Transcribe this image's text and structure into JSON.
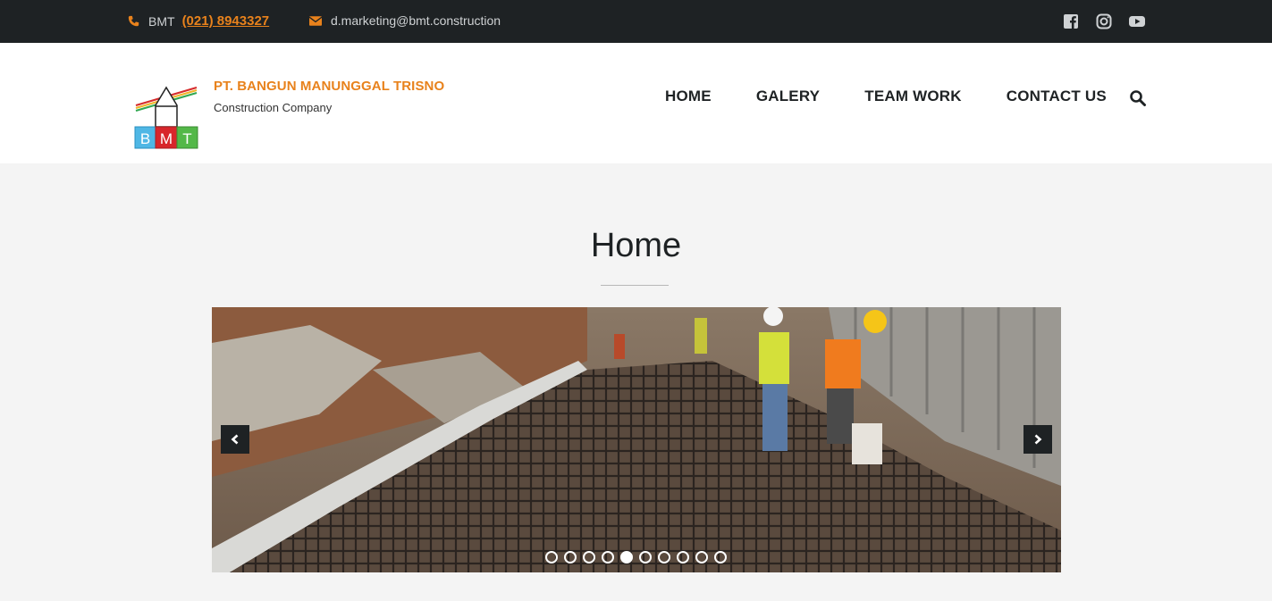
{
  "topbar": {
    "phone_brand": "BMT",
    "phone_number": "(021) 8943327",
    "email": "d.marketing@bmt.construction",
    "social": [
      "facebook-icon",
      "instagram-icon",
      "youtube-icon"
    ]
  },
  "header": {
    "logo_text": [
      "B",
      "M",
      "T"
    ],
    "company_name": "PT. BANGUN MANUNGGAL TRISNO",
    "company_sub": "Construction Company",
    "nav": [
      "HOME",
      "GALERY",
      "TEAM WORK",
      "CONTACT US"
    ]
  },
  "page": {
    "title": "Home"
  },
  "carousel": {
    "slide_count": 10,
    "active_index": 4
  },
  "colors": {
    "accent": "#e8821c",
    "topbar_bg": "#1e2224",
    "page_bg": "#f4f4f4"
  }
}
